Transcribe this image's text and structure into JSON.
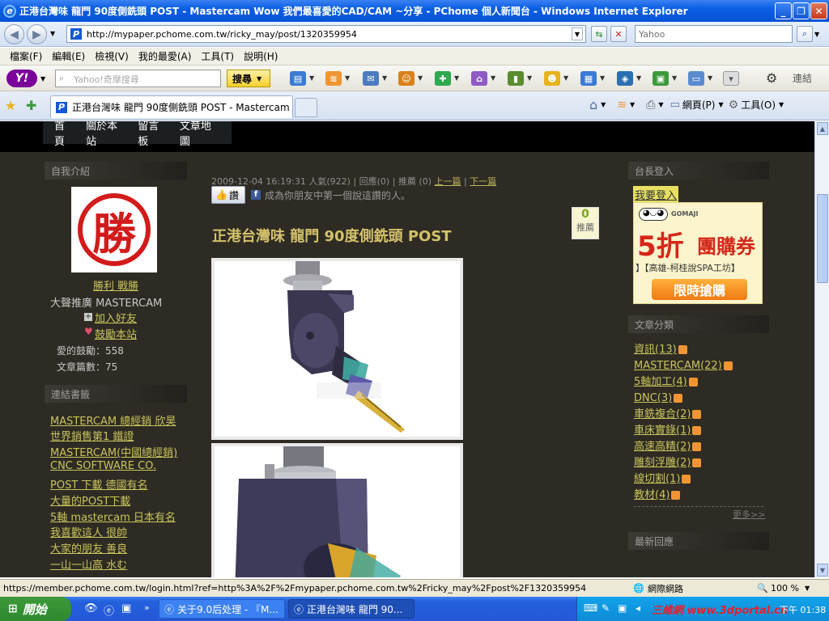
{
  "window": {
    "title": "正港台灣味 龍門 90度側銑頭 POST - Mastercam Wow 我們最喜愛的CAD/CAM ~分享 - PChome 個人新聞台 - Windows Internet Explorer"
  },
  "address": {
    "url": "http://mypaper.pchome.com.tw/ricky_may/post/1320359954",
    "search_placeholder": "Yahoo"
  },
  "menu": {
    "items": [
      "檔案(F)",
      "編輯(E)",
      "檢視(V)",
      "我的最愛(A)",
      "工具(T)",
      "說明(H)"
    ]
  },
  "yahoo_toolbar": {
    "search_placeholder": "Yahoo!奇摩搜尋",
    "search_button": "搜尋",
    "links_label": "連結"
  },
  "tab": {
    "label": "正港台灣味 龍門 90度側銑頭 POST - Mastercam Wo..."
  },
  "command_bar": {
    "page_label": "網頁(P)",
    "tools_label": "工具(O)"
  },
  "site_nav": {
    "items": [
      "首頁",
      "關於本站",
      "留言板",
      "文章地圖"
    ]
  },
  "left_sidebar": {
    "intro_header": "自我介紹",
    "avatar_char": "勝",
    "name_link": "勝利 戰勝",
    "tagline": "大聲推廣 MASTERCAM",
    "add_friend": "加入好友",
    "encourage": "鼓勵本站",
    "love_count_label": "愛的鼓勵：558",
    "article_count_label": "文章篇數：75",
    "links_header": "連結書籤",
    "links": [
      "MASTERCAM 總經銷 欣昊",
      "世界銷售第1 鐵證",
      "MASTERCAM(中國總經銷)",
      "CNC SOFTWARE CO.",
      "POST 下載 德國有名",
      "大量的POST下載",
      "5軸 mastercam 日本有名",
      "我喜歡這人 很帥",
      "大家的朋友 善良",
      "一山一山高 水む"
    ]
  },
  "post": {
    "date": "2009-12-04 16:19:31",
    "popularity": "人氣(922)",
    "replies": "回應(0)",
    "recommend": "推薦 (0)",
    "prev": "上一篇",
    "next": "下一篇",
    "like_button": "讚",
    "fb_text": "成為你朋友中第一個說這讚的人。",
    "title": "正港台灣味 龍門 90度側銑頭 POST",
    "recommend_box_count": "0",
    "recommend_box_label": "推薦"
  },
  "right_sidebar": {
    "login_header": "台長登入",
    "login_link": "我要登入",
    "ad": {
      "brand": "GOMAJI",
      "headline_big": "5折",
      "headline_small": "團購券",
      "subtitle": "】【高雄-柯桂說SPA工坊】",
      "button": "限時搶購"
    },
    "categories_header": "文章分類",
    "categories": [
      "資訊(13)",
      "MASTERCAM(22)",
      "5軸加工(4)",
      "DNC(3)",
      "車銑複合(2)",
      "車床實錄(1)",
      "高速高精(2)",
      "雕刻浮雕(2)",
      "線切割(1)",
      "教材(4)"
    ],
    "more": "更多>>",
    "latest_header": "最新回應"
  },
  "status": {
    "url": "https://member.pchome.com.tw/login.html?ref=http%3A%2F%2Fmypaper.pchome.com.tw%2Fricky_may%2Fpost%2F1320359954",
    "zone": "網際網路",
    "zoom": "100 %"
  },
  "taskbar": {
    "start": "開始",
    "tasks": [
      "关于9.0后处理 - 『M...",
      "正港台灣味 龍門 90..."
    ],
    "tray_text": "三維網 www.3dportal.cn",
    "clock": "下午 01:38"
  }
}
